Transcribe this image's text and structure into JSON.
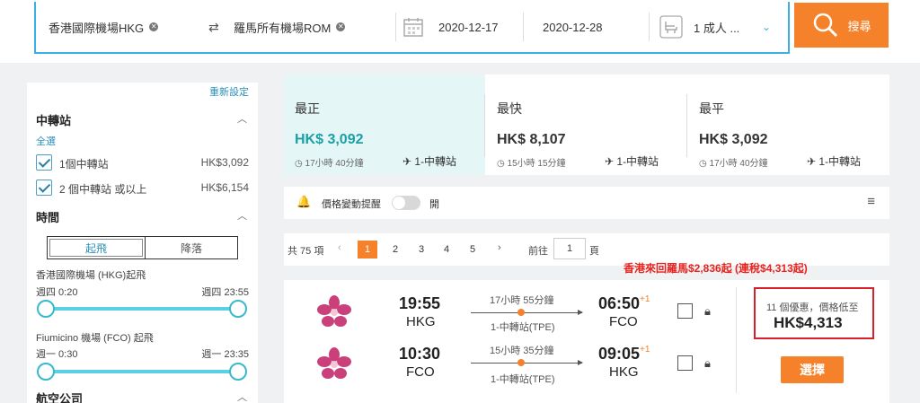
{
  "search": {
    "origin": "香港國際機場HKG",
    "destination": "羅馬所有機場ROM",
    "depart_date": "2020-12-17",
    "return_date": "2020-12-28",
    "passengers": "1 成人 ...",
    "search_label": "搜尋"
  },
  "sidebar": {
    "reset": "重新設定",
    "transit_title": "中轉站",
    "select_all": "全選",
    "stops": [
      {
        "label": "1個中轉站",
        "price": "HK$3,092"
      },
      {
        "label": "2 個中轉站 或以上",
        "price": "HK$6,154"
      }
    ],
    "time_title": "時間",
    "tab_depart": "起飛",
    "tab_land": "降落",
    "dep1_title": "香港國際機場 (HKG)起飛",
    "dep1_min": "週四 0:20",
    "dep1_max": "週四 23:55",
    "dep2_title": "Fiumicino 機場 (FCO) 起飛",
    "dep2_min": "週一 0:30",
    "dep2_max": "週一 23:35",
    "airline_title": "航空公司"
  },
  "cards": [
    {
      "label": "最正",
      "price": "HK$ 3,092",
      "duration": "17小時 40分鐘",
      "stops": "1-中轉站"
    },
    {
      "label": "最快",
      "price": "HK$ 8,107",
      "duration": "15小時 15分鐘",
      "stops": "1-中轉站"
    },
    {
      "label": "最平",
      "price": "HK$ 3,092",
      "duration": "17小時 40分鐘",
      "stops": "1-中轉站"
    }
  ],
  "alert": {
    "label": "價格變動提醒",
    "state": "開"
  },
  "pager": {
    "total": "共 75 項",
    "pages": [
      "1",
      "2",
      "3",
      "4",
      "5"
    ],
    "goto_label": "前往",
    "goto_value": "1",
    "page_unit": "頁"
  },
  "promo": "香港來回羅馬$2,836起 (連稅$4,313起)",
  "result": {
    "outbound": {
      "dep_time": "19:55",
      "dep_code": "HKG",
      "duration": "17小時 55分鐘",
      "stops": "1-中轉站(TPE)",
      "arr_time": "06:50",
      "arr_plus": "+1",
      "arr_code": "FCO"
    },
    "inbound": {
      "dep_time": "10:30",
      "dep_code": "FCO",
      "duration": "15小時 35分鐘",
      "stops": "1-中轉站(TPE)",
      "arr_time": "09:05",
      "arr_plus": "+1",
      "arr_code": "HKG"
    },
    "deal_text": "11 個優惠，價格低至",
    "deal_price": "HK$4,313",
    "select_label": "選擇"
  }
}
